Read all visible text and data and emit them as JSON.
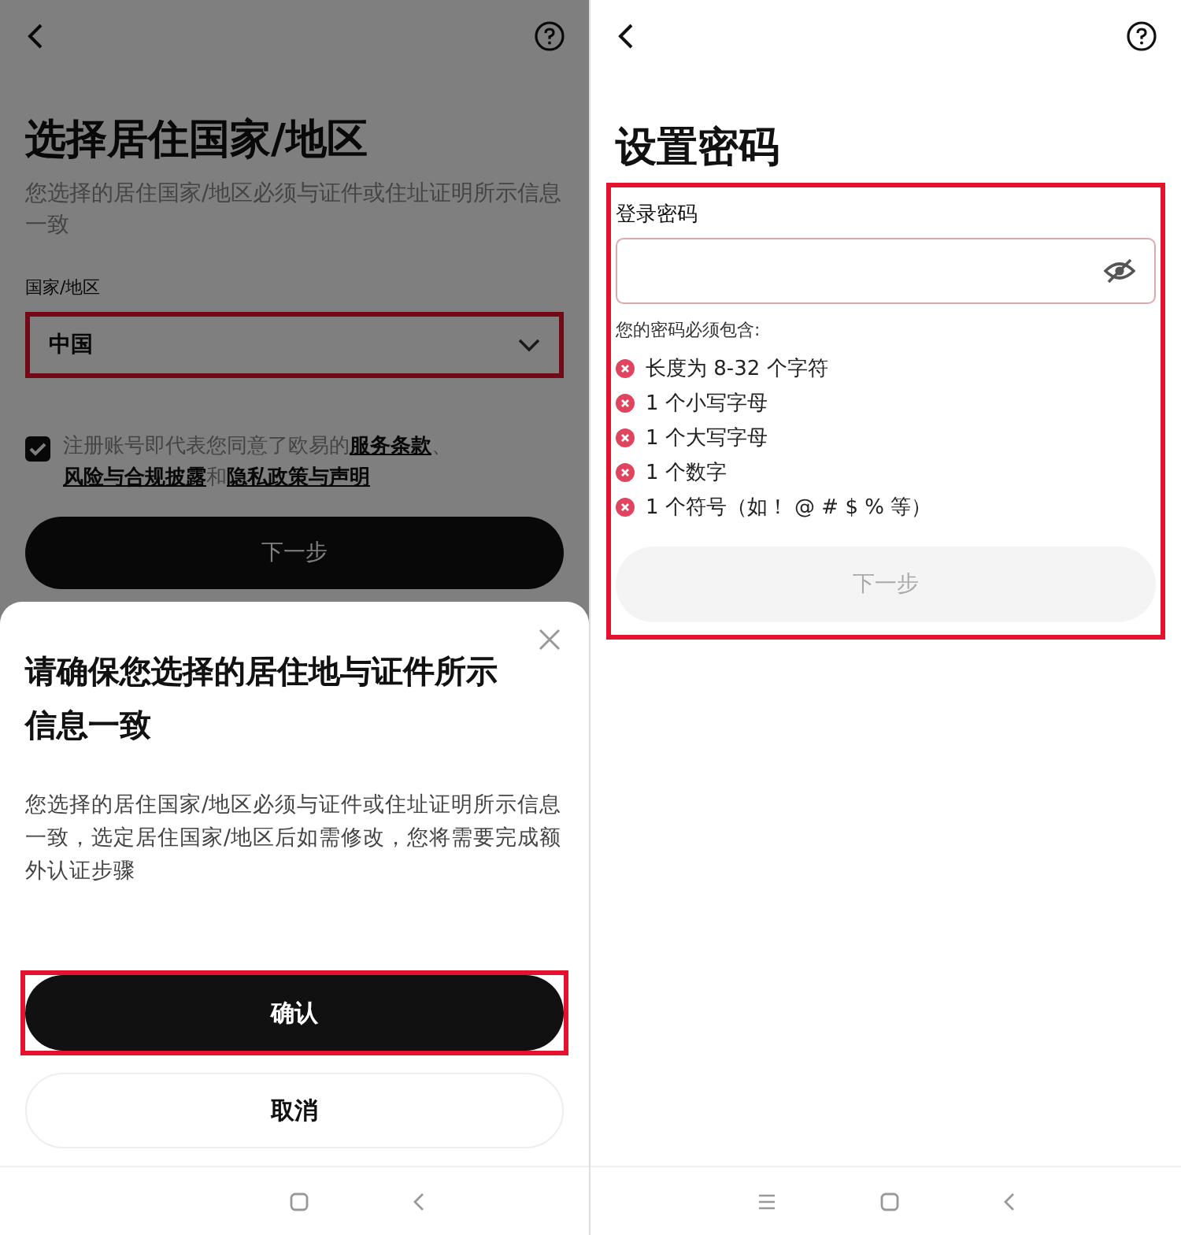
{
  "left_screen": {
    "title": "选择居住国家/地区",
    "subtitle": "您选择的居住国家/地区必须与证件或住址证明所示信息一致",
    "country_label": "国家/地区",
    "country_select": {
      "value": "中国",
      "highlighted": true
    },
    "agreement": {
      "checked": true,
      "parts": [
        {
          "kind": "text",
          "text": "注册账号即代表您同意了欧易的"
        },
        {
          "kind": "link",
          "text": "服务条款"
        },
        {
          "kind": "text",
          "text": "、"
        },
        {
          "kind": "link",
          "text": "风险与合规披露"
        },
        {
          "kind": "text",
          "text": "和"
        },
        {
          "kind": "link",
          "text": "隐私政策与声明"
        }
      ]
    },
    "next_button": {
      "label": "下一步",
      "disabled": false
    },
    "dialog": {
      "title": "请确保您选择的居住地与证件所示信息一致",
      "message": "您选择的居住国家/地区必须与证件或住址证明所示信息一致，选定居住国家/地区后如需修改，您将需要完成额外认证步骤",
      "buttons": [
        {
          "label": "确认",
          "kind": "primary",
          "highlighted": true
        },
        {
          "label": "取消",
          "kind": "secondary",
          "highlighted": false
        }
      ]
    }
  },
  "right_screen": {
    "title": "设置密码",
    "form": {
      "highlighted": true,
      "password_label": "登录密码",
      "requirements_label": "您的密码必须包含:",
      "requirements": [
        {
          "text": "长度为 8-32 个字符",
          "met": false
        },
        {
          "text": "1 个小写字母",
          "met": false
        },
        {
          "text": "1 个大写字母",
          "met": false
        },
        {
          "text": "1 个数字",
          "met": false
        },
        {
          "text": "1 个符号（如！ @ # $ % 等）",
          "met": false
        }
      ],
      "next_button": {
        "label": "下一步",
        "disabled": true
      }
    }
  }
}
